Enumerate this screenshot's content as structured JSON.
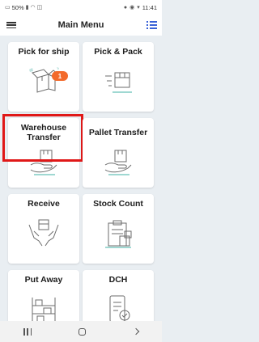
{
  "status_bar": {
    "battery": "50%",
    "time": "11:41"
  },
  "app_bar": {
    "title": "Main Menu"
  },
  "menu": {
    "items": [
      {
        "label": "Pick for ship",
        "badge": "1",
        "icon": "box-open-icon"
      },
      {
        "label": "Pick & Pack",
        "icon": "box-move-icon"
      },
      {
        "label": "Warehouse Transfer",
        "icon": "hands-box-icon",
        "selected": true
      },
      {
        "label": "Pallet Transfer",
        "icon": "hands-box-icon"
      },
      {
        "label": "Receive",
        "icon": "receive-hands-icon"
      },
      {
        "label": "Stock Count",
        "icon": "clipboard-boxes-icon"
      },
      {
        "label": "Put Away",
        "icon": "shelf-icon"
      },
      {
        "label": "DCH",
        "icon": "phone-check-icon"
      }
    ]
  },
  "colors": {
    "accent": "#3a62d7",
    "badge": "#f36a2b",
    "highlight": "#e01818",
    "background": "#e9eef2",
    "icon_stroke": "#6b6b6b"
  }
}
